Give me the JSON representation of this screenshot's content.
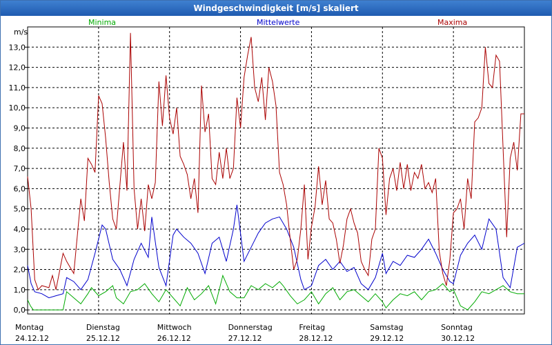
{
  "window": {
    "title": "Windgeschwindigkeit [m/s] skaliert"
  },
  "chart_data": {
    "type": "line",
    "title": "Windgeschwindigkeit [m/s] skaliert",
    "ylabel": "m/s",
    "ylim": [
      -0.2,
      14.0
    ],
    "xlim": [
      0,
      7
    ],
    "grid": true,
    "legend_placement": "top",
    "yticks": [
      "0,0",
      "1,0",
      "2,0",
      "3,0",
      "4,0",
      "5,0",
      "6,0",
      "7,0",
      "8,0",
      "9,0",
      "10,0",
      "11,0",
      "12,0",
      "13,0"
    ],
    "days": [
      {
        "name": "Montag",
        "date": "24.12.12"
      },
      {
        "name": "Dienstag",
        "date": "25.12.12"
      },
      {
        "name": "Mittwoch",
        "date": "26.12.12"
      },
      {
        "name": "Donnerstag",
        "date": "27.12.12"
      },
      {
        "name": "Freitag",
        "date": "28.12.12"
      },
      {
        "name": "Samstag",
        "date": "29.12.12"
      },
      {
        "name": "Sonntag",
        "date": "30.12.12"
      }
    ],
    "series": [
      {
        "name": "Minima",
        "color": "#00aa00",
        "x": [
          0,
          0.04,
          0.08,
          0.15,
          0.25,
          0.35,
          0.45,
          0.5,
          0.55,
          0.65,
          0.75,
          0.85,
          0.9,
          1.0,
          1.1,
          1.2,
          1.25,
          1.35,
          1.45,
          1.55,
          1.65,
          1.75,
          1.85,
          1.95,
          2.05,
          2.15,
          2.25,
          2.35,
          2.45,
          2.55,
          2.65,
          2.75,
          2.85,
          2.95,
          3.05,
          3.15,
          3.25,
          3.35,
          3.45,
          3.55,
          3.6,
          3.7,
          3.8,
          3.9,
          4.0,
          4.1,
          4.2,
          4.3,
          4.4,
          4.5,
          4.6,
          4.7,
          4.8,
          4.9,
          5.0,
          5.05,
          5.15,
          5.25,
          5.35,
          5.45,
          5.55,
          5.65,
          5.75,
          5.85,
          5.95,
          6.0,
          6.1,
          6.2,
          6.3,
          6.4,
          6.5,
          6.6,
          6.7,
          6.8,
          6.9,
          7.0
        ],
        "y": [
          0.5,
          0.2,
          0,
          0,
          0,
          0,
          0,
          0,
          0.9,
          0.6,
          0.3,
          0.8,
          1.1,
          0.7,
          0.9,
          1.2,
          0.6,
          0.3,
          0.9,
          1.0,
          1.3,
          0.8,
          0.4,
          1.0,
          0.6,
          0.2,
          1.1,
          0.5,
          0.8,
          1.2,
          0.3,
          1.7,
          0.9,
          0.6,
          0.6,
          1.2,
          1.0,
          1.3,
          1.1,
          1.4,
          1.2,
          0.7,
          0.3,
          0.5,
          0.9,
          0.3,
          0.8,
          1.1,
          0.5,
          0.9,
          1.0,
          0.7,
          0.4,
          0.8,
          0.4,
          0.1,
          0.5,
          0.8,
          0.7,
          0.9,
          0.5,
          0.9,
          1.0,
          1.3,
          0.9,
          1.0,
          0.2,
          0.0,
          0.4,
          0.9,
          0.8,
          1.0,
          1.2,
          0.9,
          0.8,
          0.8
        ]
      },
      {
        "name": "Mittelwerte",
        "color": "#0000cc",
        "x": [
          0,
          0.05,
          0.1,
          0.2,
          0.3,
          0.4,
          0.5,
          0.55,
          0.65,
          0.75,
          0.85,
          0.95,
          1.05,
          1.1,
          1.2,
          1.3,
          1.4,
          1.5,
          1.6,
          1.7,
          1.75,
          1.85,
          1.95,
          2.05,
          2.1,
          2.2,
          2.3,
          2.4,
          2.5,
          2.6,
          2.7,
          2.8,
          2.9,
          2.95,
          3.05,
          3.15,
          3.25,
          3.35,
          3.45,
          3.55,
          3.65,
          3.75,
          3.85,
          3.9,
          4.0,
          4.1,
          4.2,
          4.3,
          4.4,
          4.5,
          4.6,
          4.7,
          4.8,
          4.9,
          5.0,
          5.05,
          5.15,
          5.25,
          5.35,
          5.45,
          5.55,
          5.65,
          5.75,
          5.85,
          5.95,
          6.0,
          6.1,
          6.2,
          6.3,
          6.4,
          6.5,
          6.6,
          6.7,
          6.8,
          6.9,
          7.0
        ],
        "y": [
          2.2,
          1.3,
          0.9,
          0.8,
          0.6,
          0.7,
          0.8,
          1.6,
          1.4,
          1.0,
          1.5,
          2.8,
          4.2,
          4.0,
          2.5,
          2.0,
          1.2,
          2.5,
          3.3,
          2.6,
          4.6,
          2.1,
          1.2,
          3.7,
          4.0,
          3.6,
          3.3,
          2.8,
          1.8,
          3.3,
          3.6,
          2.4,
          4.0,
          5.2,
          2.4,
          3.1,
          3.8,
          4.3,
          4.5,
          4.6,
          4.0,
          3.1,
          1.5,
          1.0,
          1.2,
          2.2,
          2.5,
          2.0,
          2.4,
          1.9,
          2.1,
          1.3,
          1.0,
          1.6,
          2.8,
          1.8,
          2.4,
          2.2,
          2.7,
          2.6,
          3.0,
          3.5,
          2.8,
          2.0,
          1.4,
          1.3,
          2.7,
          3.3,
          3.7,
          3.0,
          4.5,
          4.0,
          1.6,
          1.1,
          3.1,
          3.3
        ]
      },
      {
        "name": "Maxima",
        "color": "#aa0000",
        "x": [
          0,
          0.05,
          0.1,
          0.15,
          0.2,
          0.3,
          0.35,
          0.4,
          0.5,
          0.55,
          0.65,
          0.75,
          0.8,
          0.85,
          0.9,
          0.95,
          1.0,
          1.05,
          1.1,
          1.15,
          1.2,
          1.25,
          1.35,
          1.4,
          1.45,
          1.5,
          1.55,
          1.6,
          1.65,
          1.7,
          1.75,
          1.8,
          1.85,
          1.9,
          1.95,
          2.0,
          2.05,
          2.1,
          2.15,
          2.2,
          2.25,
          2.3,
          2.35,
          2.4,
          2.45,
          2.5,
          2.55,
          2.6,
          2.65,
          2.7,
          2.75,
          2.8,
          2.85,
          2.9,
          2.95,
          3.0,
          3.05,
          3.1,
          3.15,
          3.2,
          3.25,
          3.3,
          3.35,
          3.4,
          3.45,
          3.5,
          3.55,
          3.6,
          3.65,
          3.7,
          3.75,
          3.8,
          3.85,
          3.9,
          3.95,
          4.0,
          4.05,
          4.1,
          4.15,
          4.2,
          4.25,
          4.3,
          4.35,
          4.4,
          4.45,
          4.5,
          4.55,
          4.6,
          4.65,
          4.7,
          4.75,
          4.8,
          4.85,
          4.9,
          4.95,
          5.0,
          5.05,
          5.1,
          5.15,
          5.2,
          5.25,
          5.3,
          5.35,
          5.4,
          5.45,
          5.5,
          5.55,
          5.6,
          5.65,
          5.7,
          5.75,
          5.8,
          5.85,
          5.9,
          5.95,
          6.0,
          6.05,
          6.1,
          6.15,
          6.2,
          6.25,
          6.3,
          6.35,
          6.4,
          6.45,
          6.5,
          6.55,
          6.6,
          6.65,
          6.7,
          6.75,
          6.8,
          6.85,
          6.9,
          6.95,
          7.0
        ],
        "y": [
          6.6,
          5.0,
          1.5,
          1.0,
          1.2,
          1.1,
          1.7,
          1.0,
          2.8,
          2.4,
          1.8,
          5.5,
          4.4,
          7.5,
          7.2,
          6.8,
          10.6,
          10.2,
          8.5,
          6.3,
          4.5,
          4.0,
          8.3,
          5.9,
          13.7,
          6.0,
          4.0,
          5.5,
          3.9,
          6.2,
          5.5,
          6.3,
          11.3,
          9.1,
          11.6,
          9.5,
          8.7,
          10.0,
          7.6,
          7.2,
          6.7,
          5.5,
          6.5,
          4.8,
          11.1,
          8.8,
          9.7,
          6.5,
          6.2,
          7.8,
          6.5,
          8.0,
          6.5,
          7.0,
          10.5,
          9.0,
          11.5,
          12.6,
          13.5,
          11.0,
          10.3,
          11.5,
          9.4,
          12.0,
          11.3,
          10.1,
          6.8,
          6.2,
          5.2,
          3.5,
          2.0,
          2.5,
          4.0,
          6.2,
          2.5,
          4.1,
          5.1,
          7.1,
          5.2,
          6.4,
          4.5,
          4.3,
          3.5,
          2.3,
          3.2,
          4.5,
          5.0,
          4.3,
          3.8,
          2.4,
          2.0,
          1.7,
          3.5,
          4.0,
          8.0,
          7.5,
          4.7,
          6.5,
          7.0,
          5.9,
          7.3,
          6.0,
          7.2,
          5.9,
          6.8,
          6.5,
          7.2,
          6.0,
          6.3,
          5.8,
          6.5,
          2.9,
          1.8,
          1.2,
          2.5,
          4.8,
          5.0,
          5.5,
          4.0,
          6.5,
          5.5,
          9.3,
          9.5,
          10.0,
          13.0,
          11.2,
          11.0,
          12.6,
          12.3,
          8.0,
          3.6,
          7.5,
          8.3,
          6.9,
          9.7,
          9.7
        ]
      }
    ]
  }
}
